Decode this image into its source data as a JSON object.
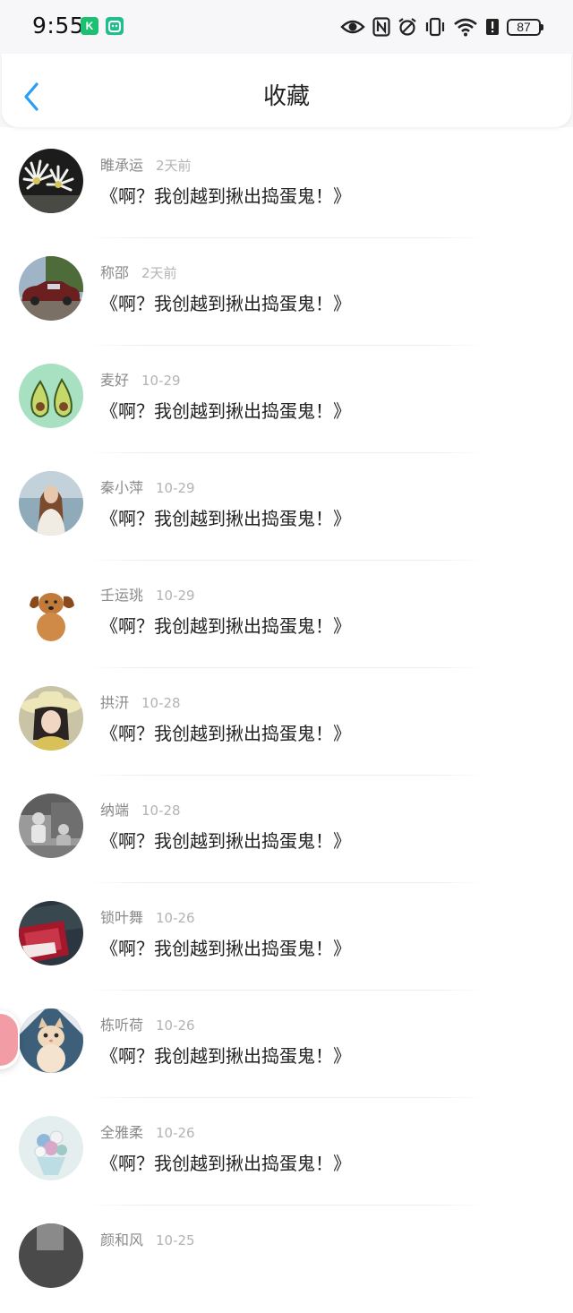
{
  "status_bar": {
    "time": "9:55",
    "battery": "87",
    "app_icons": [
      {
        "name": "k-app-icon",
        "glyph": "K",
        "color": "#1dbf73"
      },
      {
        "name": "cat-app-icon",
        "glyph": "◉",
        "color": "#21c08b"
      }
    ],
    "icons": [
      "eye-icon",
      "nfc-icon",
      "alarm-icon",
      "vibrate-icon",
      "wifi-icon",
      "alert-icon"
    ]
  },
  "header": {
    "title": "收藏",
    "accent": "#2a9df4"
  },
  "items": [
    {
      "name": "睢承运",
      "time": "2天前",
      "title": "《啊？我创越到揪出捣蛋鬼！》",
      "avatar": "flowers"
    },
    {
      "name": "称邵",
      "time": "2天前",
      "title": "《啊？我创越到揪出捣蛋鬼！》",
      "avatar": "car"
    },
    {
      "name": "麦好",
      "time": "10-29",
      "title": "《啊？我创越到揪出捣蛋鬼！》",
      "avatar": "avocado"
    },
    {
      "name": "秦小萍",
      "time": "10-29",
      "title": "《啊？我创越到揪出捣蛋鬼！》",
      "avatar": "girl-sea"
    },
    {
      "name": "壬运珧",
      "time": "10-29",
      "title": "《啊？我创越到揪出捣蛋鬼！》",
      "avatar": "dog"
    },
    {
      "name": "拱汧",
      "time": "10-28",
      "title": "《啊？我创越到揪出捣蛋鬼！》",
      "avatar": "girl-hat"
    },
    {
      "name": "纳端",
      "time": "10-28",
      "title": "《啊？我创越到揪出捣蛋鬼！》",
      "avatar": "bw-kids"
    },
    {
      "name": "锁叶舞",
      "time": "10-26",
      "title": "《啊？我创越到揪出捣蛋鬼！》",
      "avatar": "red-paper"
    },
    {
      "name": "栋听荷",
      "time": "10-26",
      "title": "《啊？我创越到揪出捣蛋鬼！》",
      "avatar": "cat"
    },
    {
      "name": "全雅柔",
      "time": "10-26",
      "title": "《啊？我创越到揪出捣蛋鬼！》",
      "avatar": "bouquet"
    },
    {
      "name": "颜和风",
      "time": "10-25",
      "title": "",
      "avatar": "partial"
    }
  ]
}
